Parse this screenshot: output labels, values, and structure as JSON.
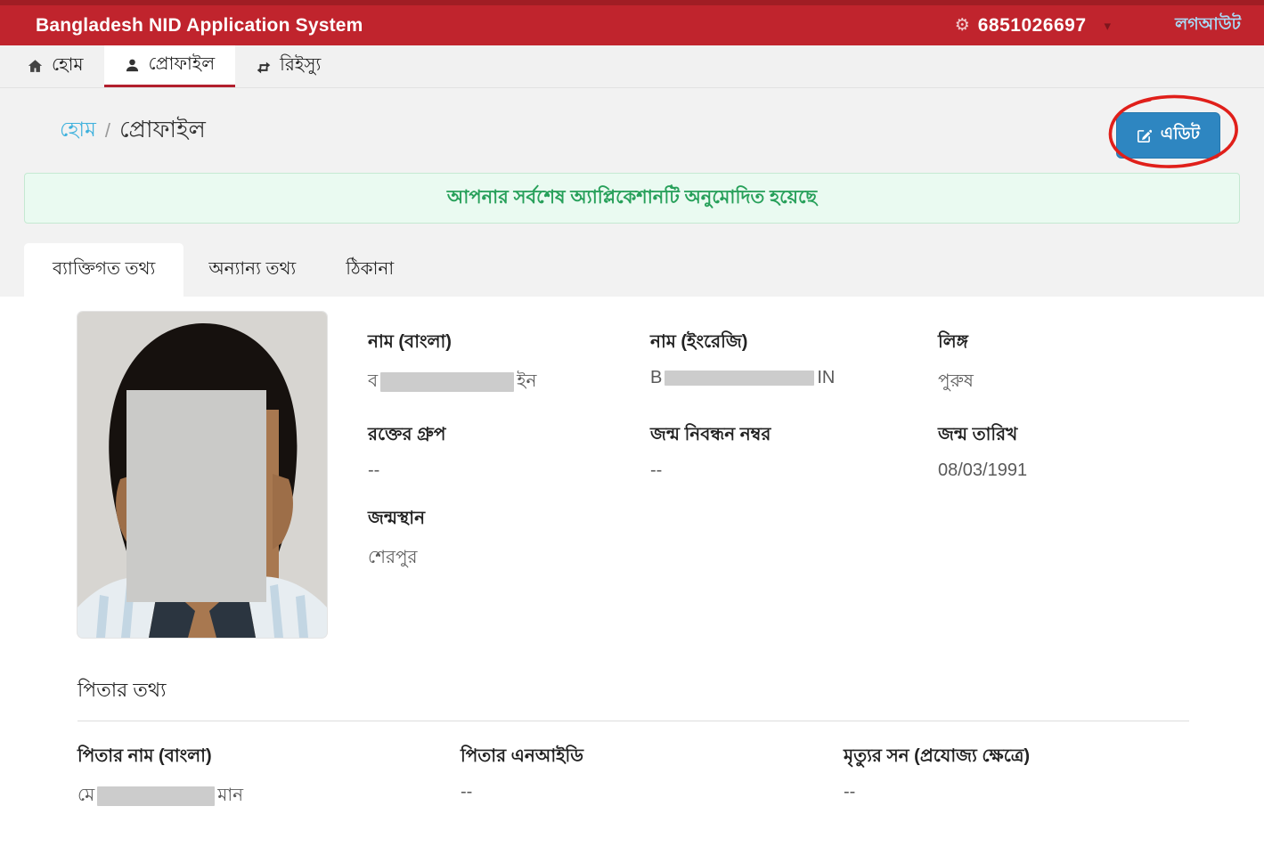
{
  "header": {
    "title": "Bangladesh NID Application System",
    "user_id": "6851026697",
    "logout_label": "লগআউট"
  },
  "icons": {
    "gear": "⚙",
    "caret_down": "▾"
  },
  "nav": {
    "items": [
      {
        "label": "হোম",
        "icon": "home-icon",
        "active": false
      },
      {
        "label": "প্রোফাইল",
        "icon": "user-icon",
        "active": true
      },
      {
        "label": "রিইস্যু",
        "icon": "reissue-icon",
        "active": false
      }
    ]
  },
  "breadcrumb": {
    "home": "হোম",
    "separator": "/",
    "current": "প্রোফাইল"
  },
  "edit_button": {
    "label": "এডিট",
    "icon": "edit-pencil-square-icon"
  },
  "alert": {
    "message": "আপনার সর্বশেষ অ্যাপ্লিকেশানটি অনুমোদিত হয়েছে"
  },
  "tabs": [
    {
      "label": "ব্যাক্তিগত তথ্য",
      "active": true
    },
    {
      "label": "অন্যান্য তথ্য",
      "active": false
    },
    {
      "label": "ঠিকানা",
      "active": false
    }
  ],
  "personal": {
    "fields": [
      {
        "label": "নাম (বাংলা)",
        "value_prefix": "ব",
        "redacted": true,
        "value_suffix": "ইন"
      },
      {
        "label": "নাম (ইংরেজি)",
        "value_prefix": "B",
        "redacted": true,
        "value_suffix": "IN"
      },
      {
        "label": "লিঙ্গ",
        "value": "পুরুষ"
      },
      {
        "label": "রক্তের গ্রুপ",
        "value": "--"
      },
      {
        "label": "জন্ম নিবন্ধন নম্বর",
        "value": "--"
      },
      {
        "label": "জন্ম তারিখ",
        "value": "08/03/1991"
      },
      {
        "label": "জন্মস্থান",
        "value": "শেরপুর"
      }
    ]
  },
  "father": {
    "section_title": "পিতার তথ্য",
    "fields": [
      {
        "label": "পিতার নাম (বাংলা)",
        "value_prefix": "মে",
        "redacted": true,
        "value_suffix": "মান"
      },
      {
        "label": "পিতার এনআইডি",
        "value": "--"
      },
      {
        "label": "মৃত্যুর সন (প্রযোজ্য ক্ষেত্রে)",
        "value": "--"
      }
    ]
  },
  "colors": {
    "header_red": "#c0242d",
    "accent_blue": "#2e86c1",
    "link_blue": "#3eb1dd",
    "alert_text_green": "#27a05a",
    "alert_bg_green": "#eafaf1",
    "annotation_red": "#e01f1a"
  }
}
